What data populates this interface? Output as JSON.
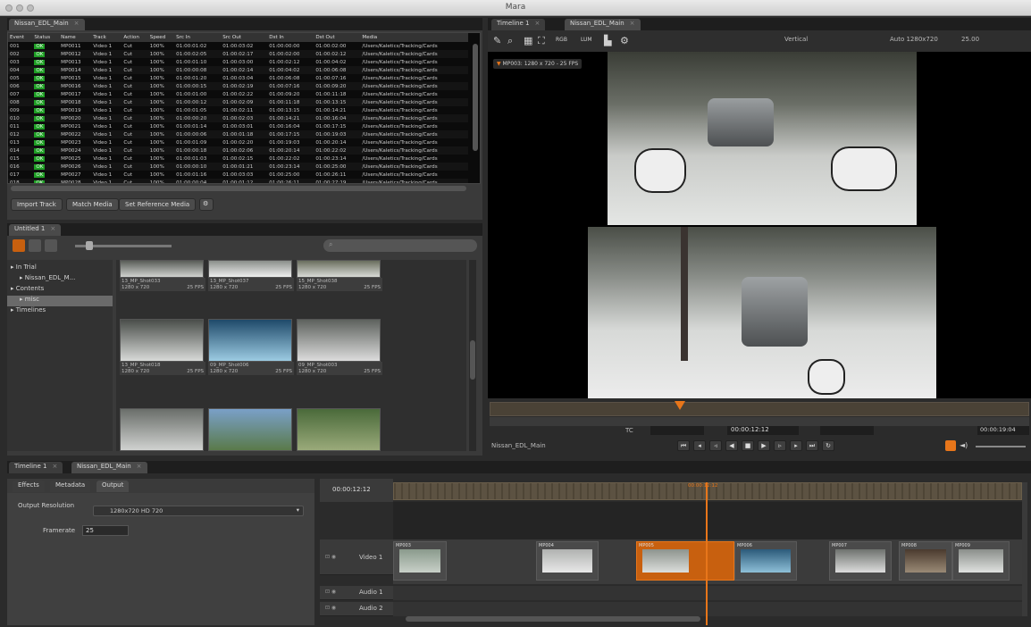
{
  "app": {
    "title": "Mara"
  },
  "top_left_panel": {
    "tab": "Nissan_EDL_Main"
  },
  "edl_table": {
    "headers": [
      "Event",
      "Status",
      "Name",
      "Track",
      "Action",
      "Speed",
      "Src In",
      "Src Out",
      "Dst In",
      "Dst Out",
      "Media"
    ],
    "rows": [
      [
        "001",
        "OK",
        "MP0011",
        "Video 1",
        "Cut",
        "100%",
        "01:00:01:02",
        "01:00:03:02",
        "01:00:00:00",
        "01:00:02:00",
        "/Users/Kaletics/Tracking/Cards"
      ],
      [
        "002",
        "OK",
        "MP0012",
        "Video 1",
        "Cut",
        "100%",
        "01:00:02:05",
        "01:00:02:17",
        "01:00:02:00",
        "01:00:02:12",
        "/Users/Kaletics/Tracking/Cards"
      ],
      [
        "003",
        "OK",
        "MP0013",
        "Video 1",
        "Cut",
        "100%",
        "01:00:01:10",
        "01:00:03:00",
        "01:00:02:12",
        "01:00:04:02",
        "/Users/Kaletics/Tracking/Cards"
      ],
      [
        "004",
        "OK",
        "MP0014",
        "Video 1",
        "Cut",
        "100%",
        "01:00:00:08",
        "01:00:02:14",
        "01:00:04:02",
        "01:00:06:08",
        "/Users/Kaletics/Tracking/Cards"
      ],
      [
        "005",
        "OK",
        "MP0015",
        "Video 1",
        "Cut",
        "100%",
        "01:00:01:20",
        "01:00:03:04",
        "01:00:06:08",
        "01:00:07:16",
        "/Users/Kaletics/Tracking/Cards"
      ],
      [
        "006",
        "OK",
        "MP0016",
        "Video 1",
        "Cut",
        "100%",
        "01:00:00:15",
        "01:00:02:19",
        "01:00:07:16",
        "01:00:09:20",
        "/Users/Kaletics/Tracking/Cards"
      ],
      [
        "007",
        "OK",
        "MP0017",
        "Video 1",
        "Cut",
        "100%",
        "01:00:01:00",
        "01:00:02:22",
        "01:00:09:20",
        "01:00:11:18",
        "/Users/Kaletics/Tracking/Cards"
      ],
      [
        "008",
        "OK",
        "MP0018",
        "Video 1",
        "Cut",
        "100%",
        "01:00:00:12",
        "01:00:02:09",
        "01:00:11:18",
        "01:00:13:15",
        "/Users/Kaletics/Tracking/Cards"
      ],
      [
        "009",
        "OK",
        "MP0019",
        "Video 1",
        "Cut",
        "100%",
        "01:00:01:05",
        "01:00:02:11",
        "01:00:13:15",
        "01:00:14:21",
        "/Users/Kaletics/Tracking/Cards"
      ],
      [
        "010",
        "OK",
        "MP0020",
        "Video 1",
        "Cut",
        "100%",
        "01:00:00:20",
        "01:00:02:03",
        "01:00:14:21",
        "01:00:16:04",
        "/Users/Kaletics/Tracking/Cards"
      ],
      [
        "011",
        "OK",
        "MP0021",
        "Video 1",
        "Cut",
        "100%",
        "01:00:01:14",
        "01:00:03:01",
        "01:00:16:04",
        "01:00:17:15",
        "/Users/Kaletics/Tracking/Cards"
      ],
      [
        "012",
        "OK",
        "MP0022",
        "Video 1",
        "Cut",
        "100%",
        "01:00:00:06",
        "01:00:01:18",
        "01:00:17:15",
        "01:00:19:03",
        "/Users/Kaletics/Tracking/Cards"
      ],
      [
        "013",
        "OK",
        "MP0023",
        "Video 1",
        "Cut",
        "100%",
        "01:00:01:09",
        "01:00:02:20",
        "01:00:19:03",
        "01:00:20:14",
        "/Users/Kaletics/Tracking/Cards"
      ],
      [
        "014",
        "OK",
        "MP0024",
        "Video 1",
        "Cut",
        "100%",
        "01:00:00:18",
        "01:00:02:06",
        "01:00:20:14",
        "01:00:22:02",
        "/Users/Kaletics/Tracking/Cards"
      ],
      [
        "015",
        "OK",
        "MP0025",
        "Video 1",
        "Cut",
        "100%",
        "01:00:01:03",
        "01:00:02:15",
        "01:00:22:02",
        "01:00:23:14",
        "/Users/Kaletics/Tracking/Cards"
      ],
      [
        "016",
        "OK",
        "MP0026",
        "Video 1",
        "Cut",
        "100%",
        "01:00:00:10",
        "01:00:01:21",
        "01:00:23:14",
        "01:00:25:00",
        "/Users/Kaletics/Tracking/Cards"
      ],
      [
        "017",
        "OK",
        "MP0027",
        "Video 1",
        "Cut",
        "100%",
        "01:00:01:16",
        "01:00:03:03",
        "01:00:25:00",
        "01:00:26:11",
        "/Users/Kaletics/Tracking/Cards"
      ],
      [
        "018",
        "OK",
        "MP0028",
        "Video 1",
        "Cut",
        "100%",
        "01:00:00:04",
        "01:00:01:12",
        "01:00:26:11",
        "01:00:27:19",
        "/Users/Kaletics/Tracking/Cards"
      ]
    ]
  },
  "edl_buttons": {
    "import": "Import Track",
    "match": "Match Media",
    "set_ref": "Set Reference Media"
  },
  "bin_panel": {
    "tab": "Untitled 1",
    "tree": [
      "In Trial",
      "Nissan_EDL_M...",
      "Contents",
      "misc",
      "Timelines"
    ],
    "thumbs": [
      {
        "name": "13_MP_Shot033",
        "info": "1280 x 720",
        "fps": "25 FPS"
      },
      {
        "name": "13_MP_Shot037",
        "info": "1280 x 720",
        "fps": "25 FPS"
      },
      {
        "name": "15_MP_Shot038",
        "info": "1280 x 720",
        "fps": "25 FPS"
      },
      {
        "name": "13_MP_Shot018",
        "info": "1280 x 720",
        "fps": "25 FPS"
      },
      {
        "name": "09_MP_Shot006",
        "info": "1280 x 720",
        "fps": "25 FPS"
      },
      {
        "name": "09_MP_Shot003",
        "info": "1280 x 720",
        "fps": "25 FPS"
      },
      {
        "name": "",
        "info": "",
        "fps": ""
      },
      {
        "name": "",
        "info": "",
        "fps": ""
      },
      {
        "name": "",
        "info": "",
        "fps": ""
      }
    ]
  },
  "viewer_panel": {
    "tabs": [
      "Timeline 1",
      "Nissan_EDL_Main"
    ],
    "label": "MP003: 1280 x 720 - 25 FPS",
    "fit_label": "Vertical",
    "resolution_label": "Auto 1280x720",
    "zoom": "25.00",
    "tc_label": "TC",
    "timecode": "00:00:12:12",
    "end_timecode": "00:00:19:04",
    "sequence_name": "Nissan_EDL_Main"
  },
  "bottom_tabs": [
    "Timeline 1",
    "Nissan_EDL_Main"
  ],
  "inspector": {
    "tabs": [
      "Effects",
      "Metadata",
      "Output"
    ],
    "output_resolution_label": "Output Resolution",
    "output_resolution_value": "1280x720 HD 720",
    "framerate_label": "Framerate",
    "framerate_value": "25"
  },
  "timeline": {
    "current_tc": "00:00:12:12",
    "playhead_tc": "00:00:12:12",
    "tracks": [
      "Video 1",
      "Audio 1",
      "Audio 2"
    ],
    "clips": [
      "MP003",
      "MP004",
      "MP005",
      "MP006",
      "MP007",
      "MP008",
      "MP009"
    ]
  },
  "colors": {
    "accent": "#e8761a",
    "status_ok": "#1f9e25",
    "selected_clip": "#c8600f"
  }
}
